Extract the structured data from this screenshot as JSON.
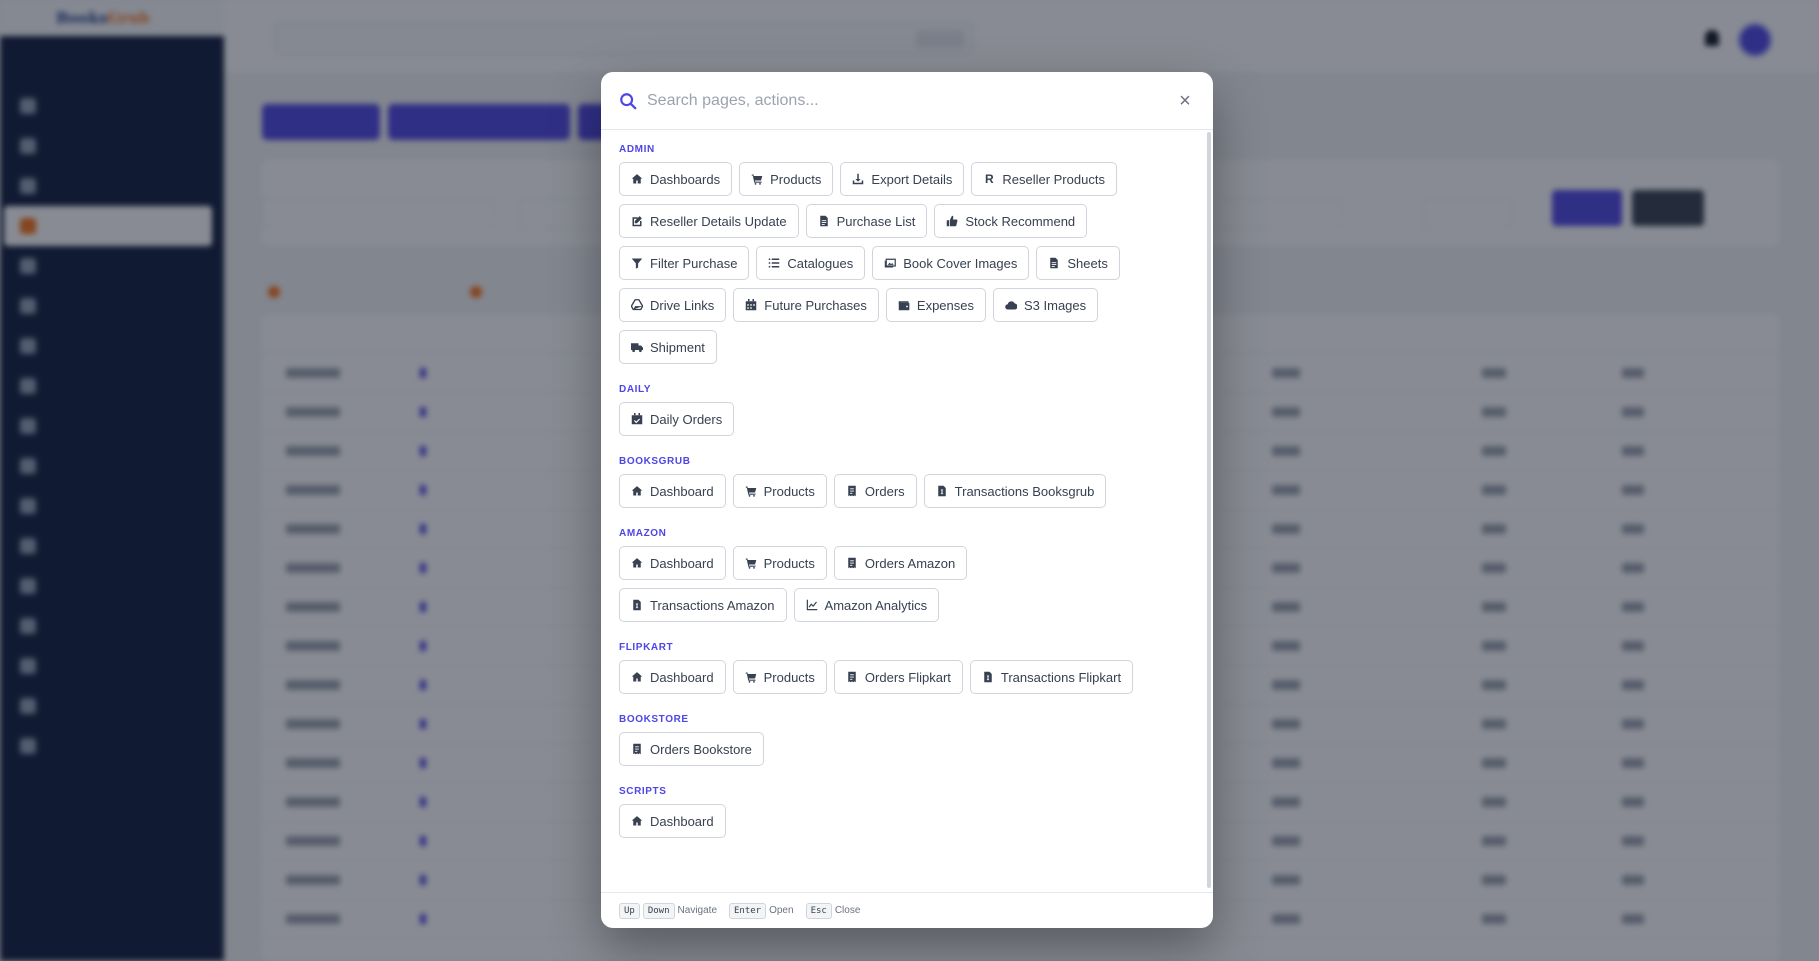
{
  "modal": {
    "search_placeholder": "Search pages, actions...",
    "close_label": "×",
    "groups": [
      {
        "title": "ADMIN",
        "items": [
          {
            "label": "Dashboards",
            "icon": "home-icon"
          },
          {
            "label": "Products",
            "icon": "cart-icon"
          },
          {
            "label": "Export Details",
            "icon": "download-icon"
          },
          {
            "label": "Reseller Products",
            "icon": "r-letter-icon"
          },
          {
            "label": "Reseller Details Update",
            "icon": "edit-icon"
          },
          {
            "label": "Purchase List",
            "icon": "file-icon"
          },
          {
            "label": "Stock Recommend",
            "icon": "thumbs-up-icon"
          },
          {
            "label": "Filter Purchase",
            "icon": "filter-icon"
          },
          {
            "label": "Catalogues",
            "icon": "list-icon"
          },
          {
            "label": "Book Cover Images",
            "icon": "images-icon"
          },
          {
            "label": "Sheets",
            "icon": "file-icon"
          },
          {
            "label": "Drive Links",
            "icon": "drive-icon"
          },
          {
            "label": "Future Purchases",
            "icon": "calendar-icon"
          },
          {
            "label": "Expenses",
            "icon": "wallet-icon"
          },
          {
            "label": "S3 Images",
            "icon": "cloud-icon"
          },
          {
            "label": "Shipment",
            "icon": "truck-icon"
          }
        ]
      },
      {
        "title": "DAILY",
        "items": [
          {
            "label": "Daily Orders",
            "icon": "calendar-check-icon"
          }
        ]
      },
      {
        "title": "BOOKSGRUB",
        "items": [
          {
            "label": "Dashboard",
            "icon": "home-icon"
          },
          {
            "label": "Products",
            "icon": "cart-icon"
          },
          {
            "label": "Orders",
            "icon": "receipt-icon"
          },
          {
            "label": "Transactions Booksgrub",
            "icon": "file-invoice-icon"
          }
        ]
      },
      {
        "title": "AMAZON",
        "items": [
          {
            "label": "Dashboard",
            "icon": "home-icon"
          },
          {
            "label": "Products",
            "icon": "cart-icon"
          },
          {
            "label": "Orders Amazon",
            "icon": "receipt-icon"
          },
          {
            "label": "Transactions Amazon",
            "icon": "file-invoice-icon"
          },
          {
            "label": "Amazon Analytics",
            "icon": "chart-line-icon"
          }
        ]
      },
      {
        "title": "FLIPKART",
        "items": [
          {
            "label": "Dashboard",
            "icon": "home-icon"
          },
          {
            "label": "Products",
            "icon": "cart-icon"
          },
          {
            "label": "Orders Flipkart",
            "icon": "receipt-icon"
          },
          {
            "label": "Transactions Flipkart",
            "icon": "file-invoice-icon"
          }
        ]
      },
      {
        "title": "BOOKSTORE",
        "items": [
          {
            "label": "Orders Bookstore",
            "icon": "receipt-icon"
          }
        ]
      },
      {
        "title": "SCRIPTS",
        "items": [
          {
            "label": "Dashboard",
            "icon": "home-icon"
          }
        ]
      }
    ],
    "footer": {
      "up_key": "Up",
      "down_key": "Down",
      "navigate_label": "Navigate",
      "enter_key": "Enter",
      "open_label": "Open",
      "esc_key": "Esc",
      "close_label": "Close"
    }
  },
  "colors": {
    "accent": "#4f46e5",
    "sidebar_bg": "#0f1d3d",
    "overlay": "rgba(17,24,39,0.5)"
  }
}
